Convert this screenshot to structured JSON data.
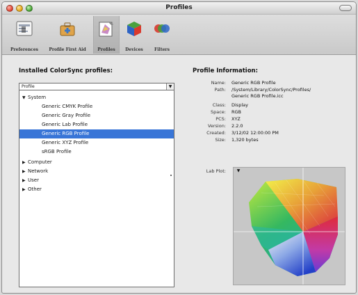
{
  "window": {
    "title": "Profiles"
  },
  "toolbar": {
    "items": [
      {
        "label": "Preferences",
        "icon": "preferences-icon"
      },
      {
        "label": "Profile First Aid",
        "icon": "first-aid-icon"
      },
      {
        "label": "Profiles",
        "icon": "profiles-icon",
        "selected": true
      },
      {
        "label": "Devices",
        "icon": "devices-icon"
      },
      {
        "label": "Filters",
        "icon": "filters-icon"
      }
    ]
  },
  "left": {
    "title": "Installed ColorSync profiles:",
    "popup_value": "Profile",
    "tree": [
      {
        "label": "System",
        "expanded": true,
        "level": 0
      },
      {
        "label": "Generic CMYK Profile",
        "level": 1
      },
      {
        "label": "Generic Gray Profile",
        "level": 1
      },
      {
        "label": "Generic Lab Profile",
        "level": 1
      },
      {
        "label": "Generic RGB Profile",
        "level": 1,
        "selected": true
      },
      {
        "label": "Generic XYZ Profile",
        "level": 1
      },
      {
        "label": "sRGB Profile",
        "level": 1
      },
      {
        "label": "Computer",
        "expanded": false,
        "level": 0
      },
      {
        "label": "Network",
        "expanded": false,
        "level": 0
      },
      {
        "label": "User",
        "expanded": false,
        "level": 0
      },
      {
        "label": "Other",
        "expanded": false,
        "level": 0
      }
    ]
  },
  "right": {
    "title": "Profile Information:",
    "fields": [
      {
        "label": "Name:",
        "value": "Generic RGB Profile"
      },
      {
        "label": "Path:",
        "value": "/System/Library/ColorSync/Profiles/"
      },
      {
        "label": "",
        "value": "Generic RGB Profile.icc"
      },
      {
        "label": "Class:",
        "value": "Display"
      },
      {
        "label": "Space:",
        "value": "RGB"
      },
      {
        "label": "PCS:",
        "value": "XYZ"
      },
      {
        "label": "Version:",
        "value": "2.2.0"
      },
      {
        "label": "Created:",
        "value": "3/12/02 12:00:00 PM"
      },
      {
        "label": "Size:",
        "value": "1,320 bytes"
      }
    ],
    "plot_label": "Lab Plot:"
  },
  "colors": {
    "selection": "#3875d7",
    "plot_background": "#c7c7c7"
  }
}
